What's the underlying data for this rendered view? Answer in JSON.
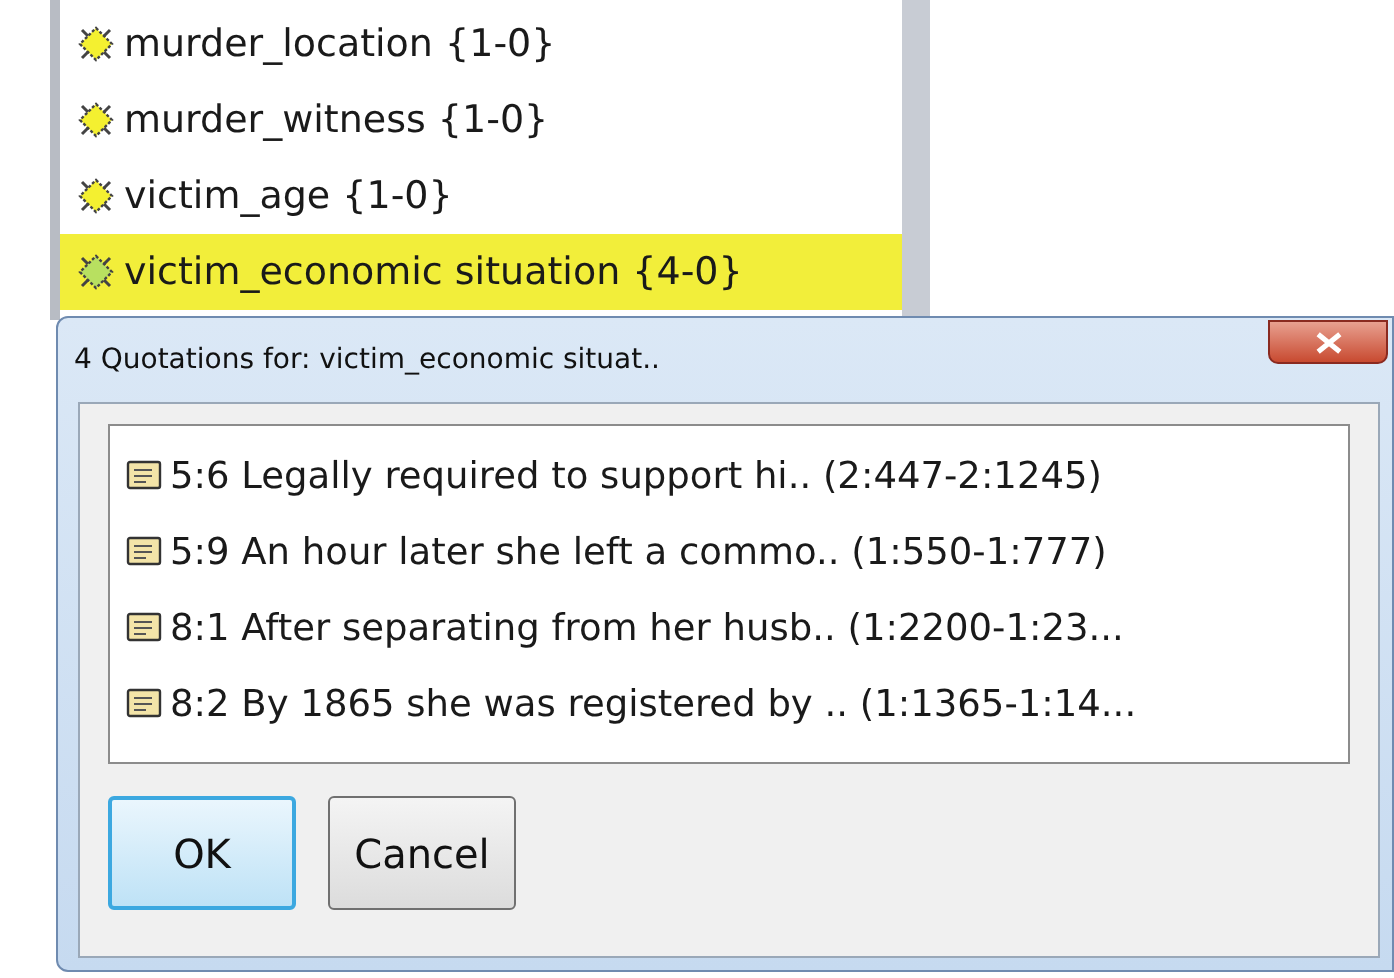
{
  "codes": [
    {
      "label": "murder_location {1-0}",
      "selected": false
    },
    {
      "label": "murder_witness {1-0}",
      "selected": false
    },
    {
      "label": "victim_age {1-0}",
      "selected": false
    },
    {
      "label": "victim_economic situation {4-0}",
      "selected": true
    }
  ],
  "dialog": {
    "title": "4 Quotations for: victim_economic situat..",
    "quotations": [
      {
        "label": "5:6 Legally required to support hi.. (2:447-2:1245)"
      },
      {
        "label": "5:9 An hour later she left a commo.. (1:550-1:777)"
      },
      {
        "label": "8:1 After separating from her husb.. (1:2200-1:23..."
      },
      {
        "label": "8:2 By 1865 she was registered by .. (1:1365-1:14..."
      }
    ],
    "buttons": [
      {
        "label": "OK",
        "kind": "default"
      },
      {
        "label": "Cancel",
        "kind": "normal"
      }
    ]
  }
}
